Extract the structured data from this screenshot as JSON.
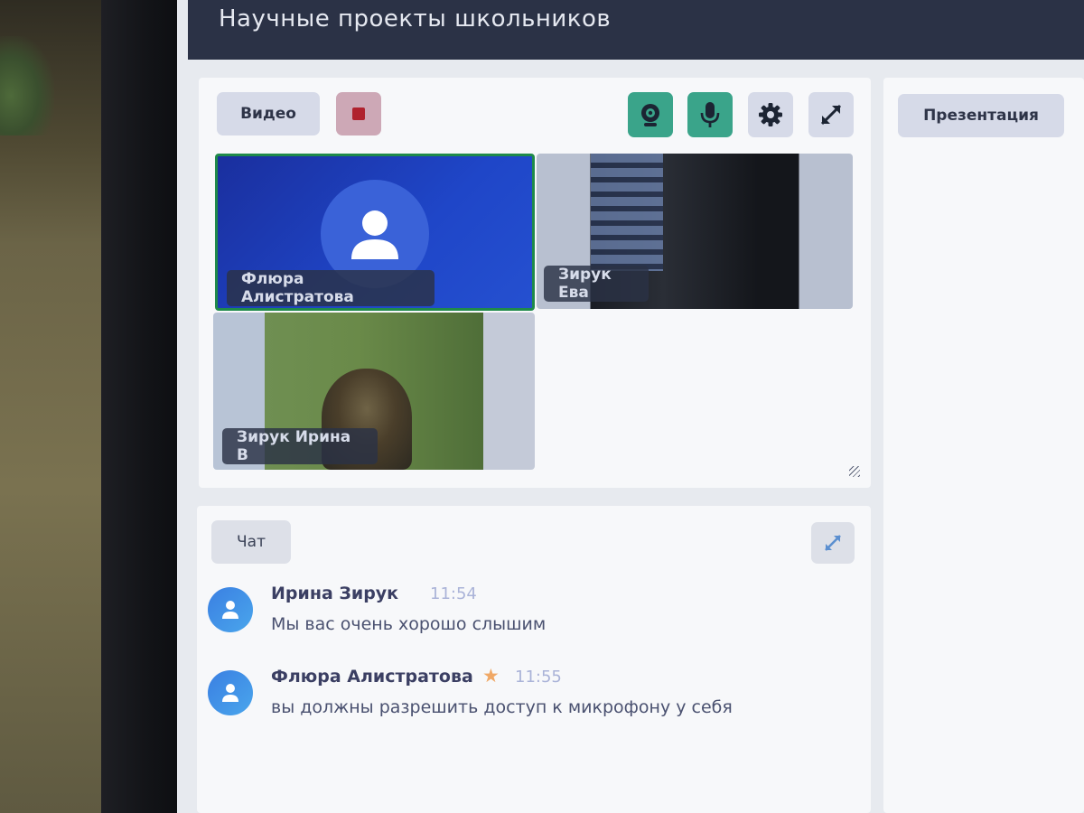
{
  "app": {
    "title": "Научные проекты школьников"
  },
  "video": {
    "label": "Видео",
    "controls": [
      "record-stop",
      "camera",
      "microphone",
      "settings",
      "fullscreen"
    ],
    "participants": [
      {
        "name": "Флюра Алистратова",
        "camera": "off",
        "active_speaker": true
      },
      {
        "name": "Зирук Ева",
        "camera": "on"
      },
      {
        "name": "Зирук Ирина В",
        "camera": "on"
      }
    ]
  },
  "chat": {
    "label": "Чат",
    "messages": [
      {
        "author": "Ирина Зирук",
        "time": "11:54",
        "text": "Мы вас очень хорошо слышим",
        "starred": false
      },
      {
        "author": "Флюра Алистратова",
        "time": "11:55",
        "text": "вы должны разрешить доступ к микрофону у себя",
        "starred": true
      }
    ]
  },
  "side": {
    "presentation_label": "Презентация"
  },
  "colors": {
    "header": "#2b3246",
    "active_control": "#3aa48a",
    "record": "#b0222e",
    "avatar": "#3a7fe2",
    "moderator_star": "#f0a866"
  }
}
